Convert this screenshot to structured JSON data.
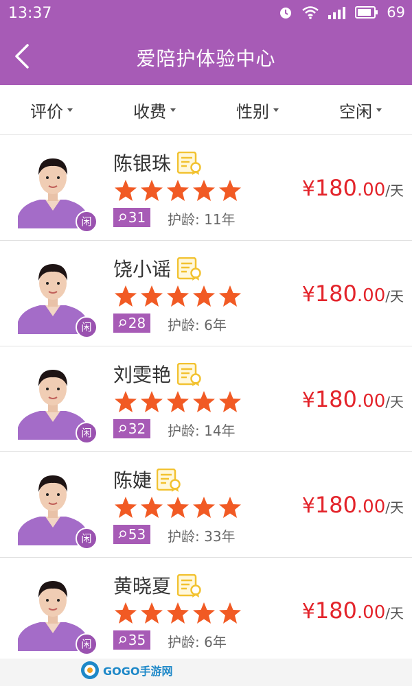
{
  "status_bar": {
    "time": "13:37",
    "battery": "69",
    "icons": [
      "alarm-icon",
      "wifi-icon",
      "signal-icon",
      "battery-icon"
    ]
  },
  "header": {
    "title": "爱陪护体验中心",
    "back_icon": "chevron-left-icon"
  },
  "filters": [
    {
      "label": "评价"
    },
    {
      "label": "收费"
    },
    {
      "label": "性别"
    },
    {
      "label": "空闲"
    }
  ],
  "caregivers": [
    {
      "name": "陈银珠",
      "rating": 5,
      "reviews": "31",
      "experience": "护龄: 11年",
      "price_symbol": "¥",
      "price_int": "180",
      "price_dec": ".00",
      "unit": "/天",
      "status": "闲"
    },
    {
      "name": "饶小谣",
      "rating": 5,
      "reviews": "28",
      "experience": "护龄: 6年",
      "price_symbol": "¥",
      "price_int": "180",
      "price_dec": ".00",
      "unit": "/天",
      "status": "闲"
    },
    {
      "name": "刘雯艳",
      "rating": 5,
      "reviews": "32",
      "experience": "护龄: 14年",
      "price_symbol": "¥",
      "price_int": "180",
      "price_dec": ".00",
      "unit": "/天",
      "status": "闲"
    },
    {
      "name": "陈婕",
      "rating": 5,
      "reviews": "53",
      "experience": "护龄: 33年",
      "price_symbol": "¥",
      "price_int": "180",
      "price_dec": ".00",
      "unit": "/天",
      "status": "闲"
    },
    {
      "name": "黄晓夏",
      "rating": 5,
      "reviews": "35",
      "experience": "护龄: 6年",
      "price_symbol": "¥",
      "price_int": "180",
      "price_dec": ".00",
      "unit": "/天",
      "status": "闲"
    }
  ],
  "watermark": {
    "text": "GOGO手游网"
  },
  "colors": {
    "brand": "#a75bb6",
    "star": "#f15a24",
    "price": "#e3242b",
    "cert": "#f2c230"
  }
}
